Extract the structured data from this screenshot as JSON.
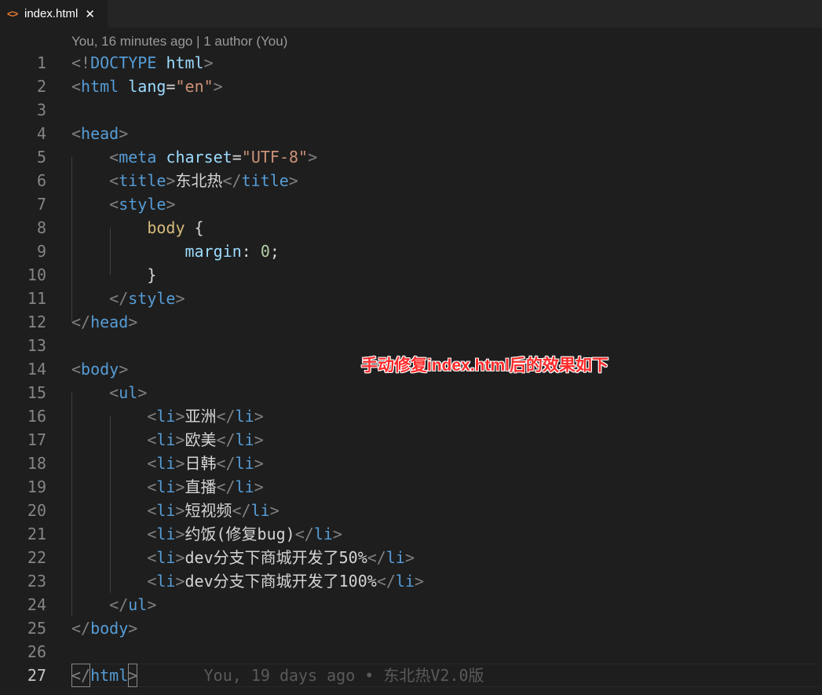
{
  "tab": {
    "icon": "html-file-icon",
    "icon_glyph": "<>",
    "label": "index.html",
    "close_glyph": "✕"
  },
  "codelens": "You, 16 minutes ago | 1 author (You)",
  "annotation": "手动修复index.html后的效果如下",
  "blame": "You, 19 days ago • 东北热V2.0版",
  "colors": {
    "background": "#1e1e1e",
    "tag": "#569cd6",
    "attribute": "#9cdcfe",
    "string": "#ce9178",
    "selector": "#d7ba7d",
    "number": "#b5cea8",
    "annotation": "#ff2a2a"
  },
  "lines": [
    {
      "n": "1",
      "tokens": [
        {
          "t": "<!",
          "c": "punc"
        },
        {
          "t": "DOCTYPE",
          "c": "tag"
        },
        {
          "t": " ",
          "c": "txt"
        },
        {
          "t": "html",
          "c": "attr"
        },
        {
          "t": ">",
          "c": "punc"
        }
      ]
    },
    {
      "n": "2",
      "tokens": [
        {
          "t": "<",
          "c": "punc"
        },
        {
          "t": "html",
          "c": "tag"
        },
        {
          "t": " ",
          "c": "txt"
        },
        {
          "t": "lang",
          "c": "attr"
        },
        {
          "t": "=",
          "c": "txt"
        },
        {
          "t": "\"en\"",
          "c": "str"
        },
        {
          "t": ">",
          "c": "punc"
        }
      ]
    },
    {
      "n": "3",
      "tokens": []
    },
    {
      "n": "4",
      "tokens": [
        {
          "t": "<",
          "c": "punc"
        },
        {
          "t": "head",
          "c": "tag"
        },
        {
          "t": ">",
          "c": "punc"
        }
      ]
    },
    {
      "n": "5",
      "tokens": [
        {
          "t": "    ",
          "c": "txt"
        },
        {
          "t": "<",
          "c": "punc"
        },
        {
          "t": "meta",
          "c": "tag"
        },
        {
          "t": " ",
          "c": "txt"
        },
        {
          "t": "charset",
          "c": "attr"
        },
        {
          "t": "=",
          "c": "txt"
        },
        {
          "t": "\"UTF-8\"",
          "c": "str"
        },
        {
          "t": ">",
          "c": "punc"
        }
      ]
    },
    {
      "n": "6",
      "tokens": [
        {
          "t": "    ",
          "c": "txt"
        },
        {
          "t": "<",
          "c": "punc"
        },
        {
          "t": "title",
          "c": "tag"
        },
        {
          "t": ">",
          "c": "punc"
        },
        {
          "t": "东北热",
          "c": "txt"
        },
        {
          "t": "</",
          "c": "punc"
        },
        {
          "t": "title",
          "c": "tag"
        },
        {
          "t": ">",
          "c": "punc"
        }
      ]
    },
    {
      "n": "7",
      "tokens": [
        {
          "t": "    ",
          "c": "txt"
        },
        {
          "t": "<",
          "c": "punc"
        },
        {
          "t": "style",
          "c": "tag"
        },
        {
          "t": ">",
          "c": "punc"
        }
      ]
    },
    {
      "n": "8",
      "tokens": [
        {
          "t": "        ",
          "c": "txt"
        },
        {
          "t": "body",
          "c": "sel"
        },
        {
          "t": " {",
          "c": "brace"
        }
      ]
    },
    {
      "n": "9",
      "tokens": [
        {
          "t": "            ",
          "c": "txt"
        },
        {
          "t": "margin",
          "c": "attr"
        },
        {
          "t": ": ",
          "c": "txt"
        },
        {
          "t": "0",
          "c": "num"
        },
        {
          "t": ";",
          "c": "txt"
        }
      ]
    },
    {
      "n": "10",
      "tokens": [
        {
          "t": "        ",
          "c": "txt"
        },
        {
          "t": "}",
          "c": "brace"
        }
      ]
    },
    {
      "n": "11",
      "tokens": [
        {
          "t": "    ",
          "c": "txt"
        },
        {
          "t": "</",
          "c": "punc"
        },
        {
          "t": "style",
          "c": "tag"
        },
        {
          "t": ">",
          "c": "punc"
        }
      ]
    },
    {
      "n": "12",
      "tokens": [
        {
          "t": "</",
          "c": "punc"
        },
        {
          "t": "head",
          "c": "tag"
        },
        {
          "t": ">",
          "c": "punc"
        }
      ]
    },
    {
      "n": "13",
      "tokens": []
    },
    {
      "n": "14",
      "tokens": [
        {
          "t": "<",
          "c": "punc"
        },
        {
          "t": "body",
          "c": "tag"
        },
        {
          "t": ">",
          "c": "punc"
        }
      ]
    },
    {
      "n": "15",
      "tokens": [
        {
          "t": "    ",
          "c": "txt"
        },
        {
          "t": "<",
          "c": "punc"
        },
        {
          "t": "ul",
          "c": "tag"
        },
        {
          "t": ">",
          "c": "punc"
        }
      ]
    },
    {
      "n": "16",
      "tokens": [
        {
          "t": "        ",
          "c": "txt"
        },
        {
          "t": "<",
          "c": "punc"
        },
        {
          "t": "li",
          "c": "tag"
        },
        {
          "t": ">",
          "c": "punc"
        },
        {
          "t": "亚洲",
          "c": "txt"
        },
        {
          "t": "</",
          "c": "punc"
        },
        {
          "t": "li",
          "c": "tag"
        },
        {
          "t": ">",
          "c": "punc"
        }
      ]
    },
    {
      "n": "17",
      "tokens": [
        {
          "t": "        ",
          "c": "txt"
        },
        {
          "t": "<",
          "c": "punc"
        },
        {
          "t": "li",
          "c": "tag"
        },
        {
          "t": ">",
          "c": "punc"
        },
        {
          "t": "欧美",
          "c": "txt"
        },
        {
          "t": "</",
          "c": "punc"
        },
        {
          "t": "li",
          "c": "tag"
        },
        {
          "t": ">",
          "c": "punc"
        }
      ]
    },
    {
      "n": "18",
      "tokens": [
        {
          "t": "        ",
          "c": "txt"
        },
        {
          "t": "<",
          "c": "punc"
        },
        {
          "t": "li",
          "c": "tag"
        },
        {
          "t": ">",
          "c": "punc"
        },
        {
          "t": "日韩",
          "c": "txt"
        },
        {
          "t": "</",
          "c": "punc"
        },
        {
          "t": "li",
          "c": "tag"
        },
        {
          "t": ">",
          "c": "punc"
        }
      ]
    },
    {
      "n": "19",
      "tokens": [
        {
          "t": "        ",
          "c": "txt"
        },
        {
          "t": "<",
          "c": "punc"
        },
        {
          "t": "li",
          "c": "tag"
        },
        {
          "t": ">",
          "c": "punc"
        },
        {
          "t": "直播",
          "c": "txt"
        },
        {
          "t": "</",
          "c": "punc"
        },
        {
          "t": "li",
          "c": "tag"
        },
        {
          "t": ">",
          "c": "punc"
        }
      ]
    },
    {
      "n": "20",
      "tokens": [
        {
          "t": "        ",
          "c": "txt"
        },
        {
          "t": "<",
          "c": "punc"
        },
        {
          "t": "li",
          "c": "tag"
        },
        {
          "t": ">",
          "c": "punc"
        },
        {
          "t": "短视频",
          "c": "txt"
        },
        {
          "t": "</",
          "c": "punc"
        },
        {
          "t": "li",
          "c": "tag"
        },
        {
          "t": ">",
          "c": "punc"
        }
      ]
    },
    {
      "n": "21",
      "tokens": [
        {
          "t": "        ",
          "c": "txt"
        },
        {
          "t": "<",
          "c": "punc"
        },
        {
          "t": "li",
          "c": "tag"
        },
        {
          "t": ">",
          "c": "punc"
        },
        {
          "t": "约饭(修复bug)",
          "c": "txt"
        },
        {
          "t": "</",
          "c": "punc"
        },
        {
          "t": "li",
          "c": "tag"
        },
        {
          "t": ">",
          "c": "punc"
        }
      ]
    },
    {
      "n": "22",
      "tokens": [
        {
          "t": "        ",
          "c": "txt"
        },
        {
          "t": "<",
          "c": "punc"
        },
        {
          "t": "li",
          "c": "tag"
        },
        {
          "t": ">",
          "c": "punc"
        },
        {
          "t": "dev分支下商城开发了50%",
          "c": "txt"
        },
        {
          "t": "</",
          "c": "punc"
        },
        {
          "t": "li",
          "c": "tag"
        },
        {
          "t": ">",
          "c": "punc"
        }
      ]
    },
    {
      "n": "23",
      "tokens": [
        {
          "t": "        ",
          "c": "txt"
        },
        {
          "t": "<",
          "c": "punc"
        },
        {
          "t": "li",
          "c": "tag"
        },
        {
          "t": ">",
          "c": "punc"
        },
        {
          "t": "dev分支下商城开发了100%",
          "c": "txt"
        },
        {
          "t": "</",
          "c": "punc"
        },
        {
          "t": "li",
          "c": "tag"
        },
        {
          "t": ">",
          "c": "punc"
        }
      ]
    },
    {
      "n": "24",
      "tokens": [
        {
          "t": "    ",
          "c": "txt"
        },
        {
          "t": "</",
          "c": "punc"
        },
        {
          "t": "ul",
          "c": "tag"
        },
        {
          "t": ">",
          "c": "punc"
        }
      ]
    },
    {
      "n": "25",
      "tokens": [
        {
          "t": "</",
          "c": "punc"
        },
        {
          "t": "body",
          "c": "tag"
        },
        {
          "t": ">",
          "c": "punc"
        }
      ]
    },
    {
      "n": "26",
      "tokens": []
    },
    {
      "n": "27",
      "tokens": [
        {
          "t": "</",
          "c": "punc",
          "box": true
        },
        {
          "t": "html",
          "c": "tag"
        },
        {
          "t": ">",
          "c": "punc",
          "box": true
        }
      ]
    }
  ]
}
